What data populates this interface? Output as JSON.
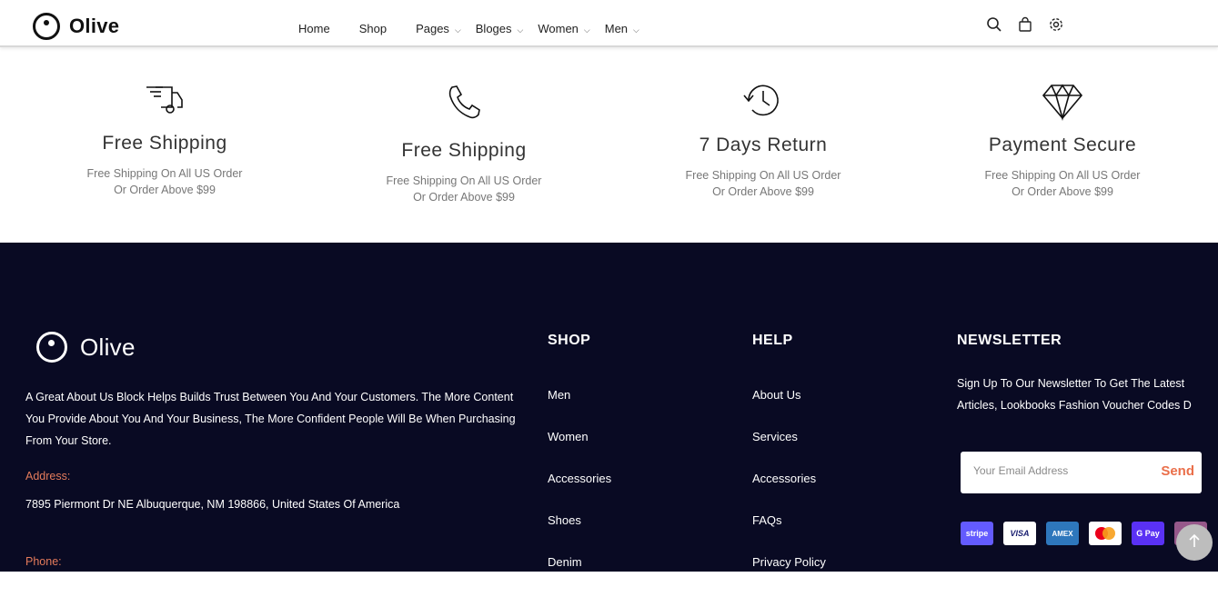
{
  "header": {
    "logo_text": "Olive",
    "nav": [
      {
        "label": "Home",
        "dropdown": false
      },
      {
        "label": "Shop",
        "dropdown": false
      },
      {
        "label": "Pages",
        "dropdown": true
      },
      {
        "label": "Bloges",
        "dropdown": true
      },
      {
        "label": "Women",
        "dropdown": true
      },
      {
        "label": "Men",
        "dropdown": true
      }
    ],
    "icons": [
      "search-icon",
      "shopping-bag-icon",
      "settings-icon"
    ]
  },
  "features": [
    {
      "icon": "delivery-truck-icon",
      "title": "Free Shipping",
      "line1": "Free Shipping On All US Order",
      "line2": "Or Order Above $99"
    },
    {
      "icon": "phone-icon",
      "title": "Free Shipping",
      "line1": "Free Shipping On All US Order",
      "line2": "Or Order Above $99"
    },
    {
      "icon": "history-clock-icon",
      "title": "7 Days Return",
      "line1": "Free Shipping On All US Order",
      "line2": "Or Order Above $99"
    },
    {
      "icon": "diamond-icon",
      "title": "Payment Secure",
      "line1": "Free Shipping On All US Order",
      "line2": "Or Order Above $99"
    }
  ],
  "footer": {
    "logo_text": "Olive",
    "about": "A Great About Us Block Helps Builds Trust Between You And Your Customers. The More Content You Provide About You And Your Business, The More Confident People Will Be When Purchasing From Your Store.",
    "address_label": "Address:",
    "address": "7895 Piermont Dr NE Albuquerque, NM 198866, United States Of America",
    "phone_label": "Phone:",
    "shop": {
      "heading": "SHOP",
      "items": [
        "Men",
        "Women",
        "Accessories",
        "Shoes",
        "Denim"
      ]
    },
    "help": {
      "heading": "HELP",
      "items": [
        "About Us",
        "Services",
        "Accessories",
        "FAQs",
        "Privacy Policy"
      ]
    },
    "newsletter": {
      "heading": "NEWSLETTER",
      "text_line1": "Sign Up To Our Newsletter To Get The Latest",
      "text_line2": "Articles, Lookbooks Fashion Voucher Codes D",
      "placeholder": "Your Email Address",
      "send_label": "Send"
    },
    "payments": [
      {
        "label": "stripe",
        "color": "#635bff"
      },
      {
        "label": "VISA",
        "color": "#ffffff"
      },
      {
        "label": "AMEX",
        "color": "#2e77bc"
      },
      {
        "label": "",
        "color": "#ffffff"
      },
      {
        "label": "G Pay",
        "color": "#5a31f4"
      },
      {
        "label": "",
        "color": "#96588a"
      }
    ]
  },
  "colors": {
    "footer_bg": "#090a23",
    "accent": "#ea6f4a"
  }
}
